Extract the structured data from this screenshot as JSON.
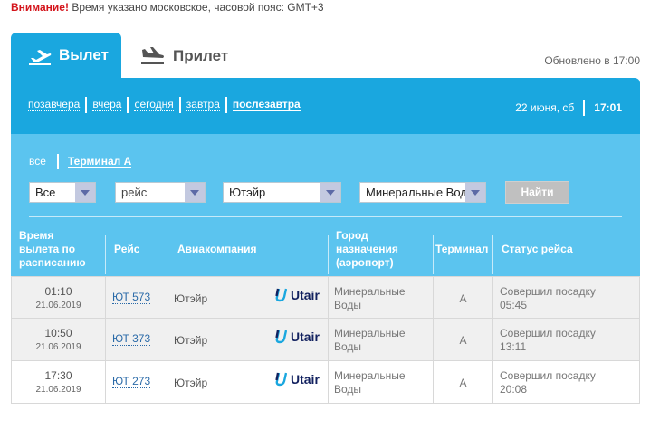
{
  "notice": {
    "label": "Внимание!",
    "text": " Время указано московское, часовой пояс: GMT+3"
  },
  "tabs": {
    "departure": {
      "label": "Вылет",
      "icon": "plane-takeoff-icon",
      "active": true
    },
    "arrival": {
      "label": "Прилет",
      "icon": "plane-landing-icon",
      "active": false
    }
  },
  "updated": "Обновлено в 17:00",
  "days": [
    {
      "label": "позавчера",
      "active": false
    },
    {
      "label": "вчера",
      "active": false
    },
    {
      "label": "сегодня",
      "active": false
    },
    {
      "label": "завтра",
      "active": false
    },
    {
      "label": "послезавтра",
      "active": true
    }
  ],
  "date": {
    "day": "22 июня, сб",
    "time": "17:01"
  },
  "terminal_filter": [
    {
      "label": "все",
      "active": false
    },
    {
      "label": "Терминал А",
      "active": true
    }
  ],
  "filters": {
    "terminal": "Все",
    "flight": "рейс",
    "airline": "Ютэйр",
    "city": "Минеральные Воды",
    "search_label": "Найти"
  },
  "columns": {
    "time": [
      "Время",
      "вылета по",
      "расписанию"
    ],
    "flight": "Рейс",
    "airline": "Авиакомпания",
    "city": [
      "Город",
      "назначения",
      "(аэропорт)"
    ],
    "terminal": "Терминал",
    "status": "Статус рейса"
  },
  "rows": [
    {
      "time": "01:10",
      "date": "21.06.2019",
      "flight": "ЮТ 573",
      "airline": "Ютэйр",
      "logo": "Utair",
      "city": [
        "Минеральные",
        "Воды"
      ],
      "terminal": "A",
      "status": [
        "Совершил посадку",
        "05:45"
      ]
    },
    {
      "time": "10:50",
      "date": "21.06.2019",
      "flight": "ЮТ 373",
      "airline": "Ютэйр",
      "logo": "Utair",
      "city": [
        "Минеральные",
        "Воды"
      ],
      "terminal": "A",
      "status": [
        "Совершил посадку",
        "13:11"
      ]
    },
    {
      "time": "17:30",
      "date": "21.06.2019",
      "flight": "ЮТ 273",
      "airline": "Ютэйр",
      "logo": "Utair",
      "city": [
        "Минеральные",
        "Воды"
      ],
      "terminal": "A",
      "status": [
        "Совершил посадку",
        "20:08"
      ]
    }
  ],
  "colors": {
    "accent": "#1aa7df",
    "filter_bg": "#5bc4ef",
    "warning": "#d4141b",
    "logo": "#12215f"
  }
}
